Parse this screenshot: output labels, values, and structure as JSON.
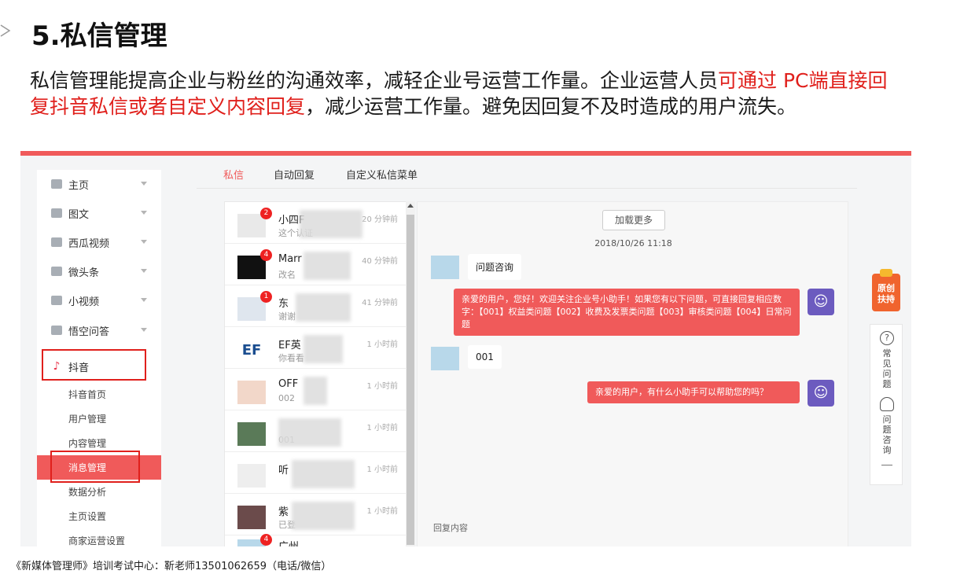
{
  "slide": {
    "title": "5.私信管理",
    "intro_parts": [
      {
        "text": "私信管理能提高企业与粉丝的沟通效率，减轻企业号运营工作量。企业运营人员",
        "highlight": false
      },
      {
        "text": "可通过 PC端直接回复抖音私信或者自定义内容回复",
        "highlight": true
      },
      {
        "text": "，减少运营工作量。避免因回复不及时造成的用户流失。",
        "highlight": false
      }
    ],
    "footer": "《新媒体管理师》培训考试中心：靳老师13501062659（电话/微信）",
    "accent_color": "#e0201c"
  },
  "sidebar": {
    "items": [
      {
        "label": "主页",
        "icon": "home-icon"
      },
      {
        "label": "图文",
        "icon": "article-icon"
      },
      {
        "label": "西瓜视频",
        "icon": "video-icon"
      },
      {
        "label": "微头条",
        "icon": "chat-icon"
      },
      {
        "label": "小视频",
        "icon": "tiktok-icon"
      },
      {
        "label": "悟空问答",
        "icon": "qa-icon"
      }
    ],
    "douyin": {
      "label": "抖音",
      "icon": "douyin-icon"
    },
    "sub_items": [
      "抖音首页",
      "用户管理",
      "内容管理",
      "消息管理",
      "数据分析",
      "主页设置",
      "商家运营设置"
    ],
    "active_sub": "消息管理"
  },
  "tabs": [
    "私信",
    "自动回复",
    "自定义私信菜单"
  ],
  "active_tab": "私信",
  "conversations": [
    {
      "name": "小四F",
      "preview": "这个认证",
      "time": "20 分钟前",
      "badge": "2"
    },
    {
      "name": "Marr",
      "preview": "改名",
      "time": "40 分钟前",
      "badge": "4"
    },
    {
      "name": "东",
      "preview": "谢谢",
      "time": "41 分钟前",
      "badge": "1"
    },
    {
      "name": "EF英",
      "preview": "你看看",
      "time": "1 小时前",
      "badge": ""
    },
    {
      "name": "OFF",
      "preview": "002",
      "time": "1 小时前",
      "badge": ""
    },
    {
      "name": "",
      "preview": "001",
      "time": "1 小时前",
      "badge": ""
    },
    {
      "name": "听",
      "preview": "",
      "time": "1 小时前",
      "badge": ""
    },
    {
      "name": "紫",
      "preview": "已登",
      "time": "1 小时前",
      "badge": ""
    },
    {
      "name": "广州",
      "preview": "",
      "time": "",
      "badge": "4"
    }
  ],
  "chat": {
    "load_more": "加载更多",
    "timestamp": "2018/10/26 11:18",
    "messages": [
      {
        "from": "user",
        "text": "问题咨询"
      },
      {
        "from": "bot",
        "text": "亲爱的用户，您好！欢迎关注企业号小助手！如果您有以下问题，可直接回复相应数字：【001】权益类问题【002】收费及发票类问题【003】审核类问题【004】日常问题"
      },
      {
        "from": "user",
        "text": "001"
      },
      {
        "from": "bot",
        "text": "亲爱的用户，有什么小助手可以帮助您的吗？"
      }
    ],
    "reply_placeholder": "回复内容"
  },
  "float": {
    "hot_label": "原创扶持",
    "faq_label": "常见问题",
    "consult_label": "问题咨询"
  }
}
